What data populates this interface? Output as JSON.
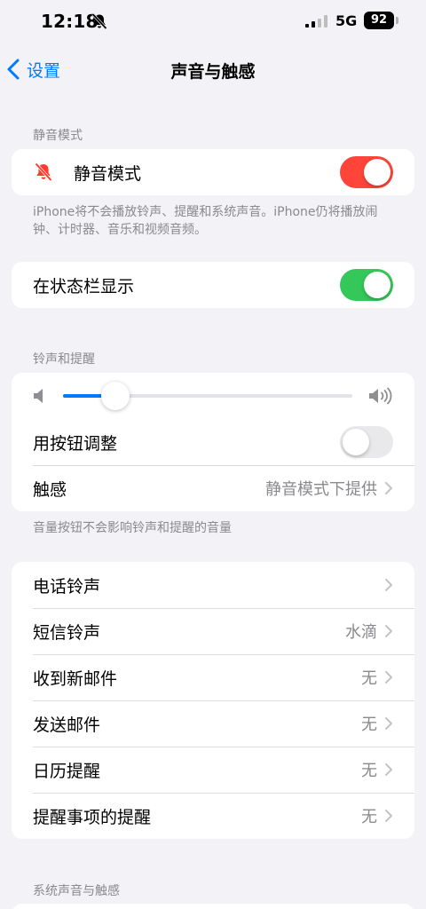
{
  "status_bar": {
    "time": "12:18",
    "network": "5G",
    "battery": "92"
  },
  "nav": {
    "back_label": "设置",
    "title": "声音与触感"
  },
  "silent_section": {
    "header": "静音模式",
    "row_label": "静音模式",
    "footer": "iPhone将不会播放铃声、提醒和系统声音。iPhone仍将播放闹钟、计时器、音乐和视频音频。"
  },
  "status_bar_section": {
    "row_label": "在状态栏显示"
  },
  "ringer_section": {
    "header": "铃声和提醒",
    "volume_level": 0.18,
    "adjust_label": "用按钮调整",
    "haptics_label": "触感",
    "haptics_value": "静音模式下提供",
    "footer": "音量按钮不会影响铃声和提醒的音量"
  },
  "sounds_section": {
    "items": [
      {
        "label": "电话铃声",
        "value": ""
      },
      {
        "label": "短信铃声",
        "value": "水滴"
      },
      {
        "label": "收到新邮件",
        "value": "无"
      },
      {
        "label": "发送邮件",
        "value": "无"
      },
      {
        "label": "日历提醒",
        "value": "无"
      },
      {
        "label": "提醒事项的提醒",
        "value": "无"
      }
    ]
  },
  "system_section": {
    "header": "系统声音与触感"
  },
  "colors": {
    "accent_blue": "#007aff",
    "toggle_orange": "#ff453a",
    "toggle_green": "#34c759",
    "toggle_off": "#e9e9eb",
    "slider_fill": "#007aff",
    "muted_bell": "#ff3b30"
  }
}
